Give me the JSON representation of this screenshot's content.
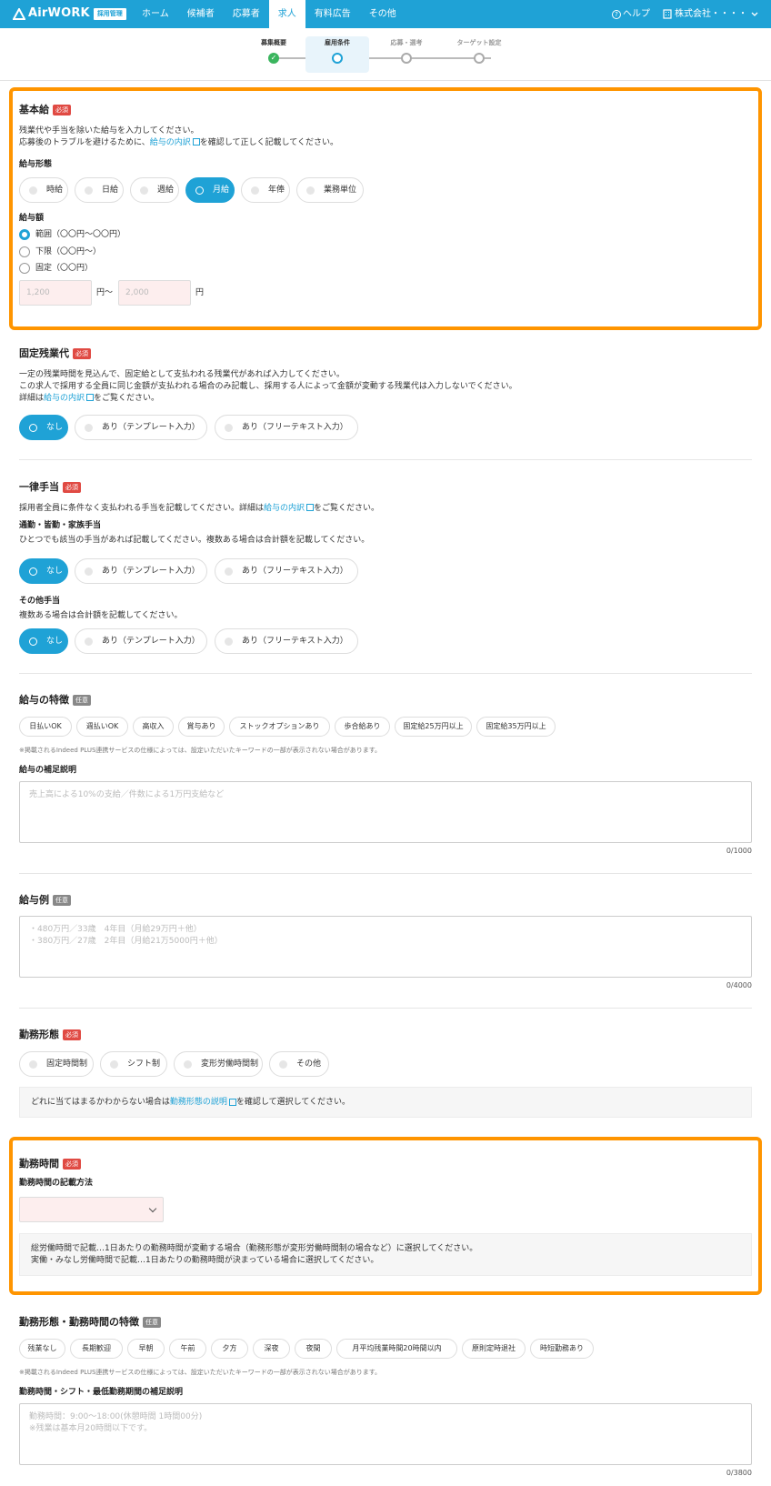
{
  "header": {
    "logo": "AirWORK",
    "logo_badge": "採用管理",
    "nav": [
      "ホーム",
      "候補者",
      "応募者",
      "求人",
      "有料広告",
      "その他"
    ],
    "active_nav": "求人",
    "help": "ヘルプ",
    "company": "株式会社・・・・"
  },
  "stepper": {
    "steps": [
      {
        "label": "募集概要",
        "state": "done"
      },
      {
        "label": "雇用条件",
        "state": "current"
      },
      {
        "label": "応募・選考",
        "state": "todo"
      },
      {
        "label": "ターゲット設定",
        "state": "todo"
      }
    ]
  },
  "base_pay": {
    "title": "基本給",
    "badge": "必須",
    "desc1": "残業代や手当を除いた給与を入力してください。",
    "desc2_pre": "応募後のトラブルを避けるために、",
    "desc2_link": "給与の内訳",
    "desc2_post": "を確認して正しく記載してください。",
    "type_label": "給与形態",
    "types": [
      "時給",
      "日給",
      "週給",
      "月給",
      "年俸",
      "業務単位"
    ],
    "selected_type": "月給",
    "amount_label": "給与額",
    "amount_options": [
      "範囲（〇〇円〜〇〇円）",
      "下限（〇〇円〜）",
      "固定（〇〇円）"
    ],
    "min_placeholder": "1,200",
    "between": "円〜",
    "max_placeholder": "2,000",
    "unit": "円"
  },
  "fixed_overtime": {
    "title": "固定残業代",
    "badge": "必須",
    "desc1": "一定の残業時間を見込んで、固定給として支払われる残業代があれば入力してください。",
    "desc2": "この求人で採用する全員に同じ金額が支払われる場合のみ記載し、採用する人によって金額が変動する残業代は入力しないでください。",
    "desc3_pre": "詳細は",
    "desc3_link": "給与の内訳",
    "desc3_post": "をご覧ください。",
    "options": [
      "なし",
      "あり（テンプレート入力）",
      "あり（フリーテキスト入力）"
    ]
  },
  "allowance": {
    "title": "一律手当",
    "badge": "必須",
    "desc_pre": "採用者全員に条件なく支払われる手当を記載してください。詳細は",
    "desc_link": "給与の内訳",
    "desc_post": "をご覧ください。",
    "commute_title": "通勤・皆勤・家族手当",
    "commute_desc": "ひとつでも該当の手当があれば記載してください。複数ある場合は合計額を記載してください。",
    "other_title": "その他手当",
    "other_desc": "複数ある場合は合計額を記載してください。",
    "options": [
      "なし",
      "あり（テンプレート入力）",
      "あり（フリーテキスト入力）"
    ]
  },
  "pay_features": {
    "title": "給与の特徴",
    "badge": "任意",
    "tags": [
      "日払いOK",
      "週払いOK",
      "高収入",
      "賞与あり",
      "ストックオプションあり",
      "歩合給あり",
      "固定給25万円以上",
      "固定給35万円以上"
    ],
    "note": "※掲載されるIndeed PLUS連携サービスの仕様によっては、設定いただいたキーワードの一部が表示されない場合があります。",
    "supp_title": "給与の補足説明",
    "supp_placeholder": "売上高による10%の支給／件数による1万円支給など",
    "supp_count": "0/1000"
  },
  "pay_example": {
    "title": "給与例",
    "badge": "任意",
    "line1": "・480万円／33歳　4年目（月給29万円＋他）",
    "line2": "・380万円／27歳　2年目（月給21万5000円＋他）",
    "count": "0/4000"
  },
  "work_style": {
    "title": "勤務形態",
    "badge": "必須",
    "options": [
      "固定時間制",
      "シフト制",
      "変形労働時間制",
      "その他"
    ],
    "info_pre": "どれに当てはまるかわからない場合は",
    "info_link": "勤務形態の説明",
    "info_post": "を確認して選択してください。"
  },
  "work_hours": {
    "title": "勤務時間",
    "badge": "必須",
    "method_label": "勤務時間の記載方法",
    "info1": "総労働時間で記載…1日あたりの勤務時間が変動する場合（勤務形態が変形労働時間制の場合など）に選択してください。",
    "info2": "実働・みなし労働時間で記載…1日あたりの勤務時間が決まっている場合に選択してください。"
  },
  "hours_features": {
    "title": "勤務形態・勤務時間の特徴",
    "badge": "任意",
    "tags": [
      "残業なし",
      "長期歓迎",
      "早朝",
      "午前",
      "夕方",
      "深夜",
      "夜間",
      "月平均残業時間20時間以内",
      "原則定時退社",
      "時短勤務あり"
    ],
    "note": "※掲載されるIndeed PLUS連携サービスの仕様によっては、設定いただいたキーワードの一部が表示されない場合があります。",
    "supp_title": "勤務時間・シフト・最低勤務期間の補足説明",
    "line1": "勤務時間：9:00〜18:00(休憩時間 1時間00分)",
    "line2": "※残業は基本月20時間以下です。",
    "count": "0/3800"
  },
  "colors": {
    "accent": "#1fa2d6",
    "highlight": "#ff9500",
    "required": "#e04a43"
  }
}
